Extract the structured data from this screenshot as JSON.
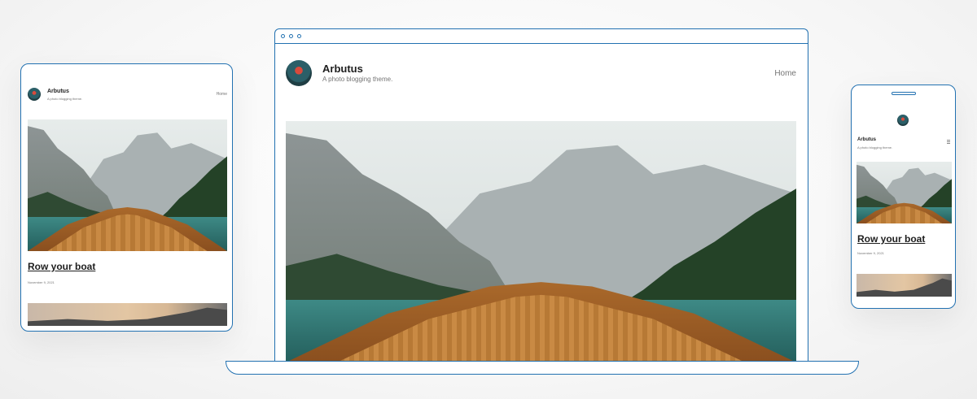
{
  "site": {
    "title": "Arbutus",
    "tagline": "A photo blogging theme.",
    "nav_home": "Home"
  },
  "post": {
    "title": "Row your boat",
    "date": "November 9, 2021"
  },
  "colors": {
    "device_outline": "#2271b1",
    "text": "#1e1e1e",
    "muted": "#757575"
  },
  "icons": {
    "window_dots": "window-control-dots",
    "menu": "menu-icon",
    "avatar": "site-logo-avatar"
  }
}
